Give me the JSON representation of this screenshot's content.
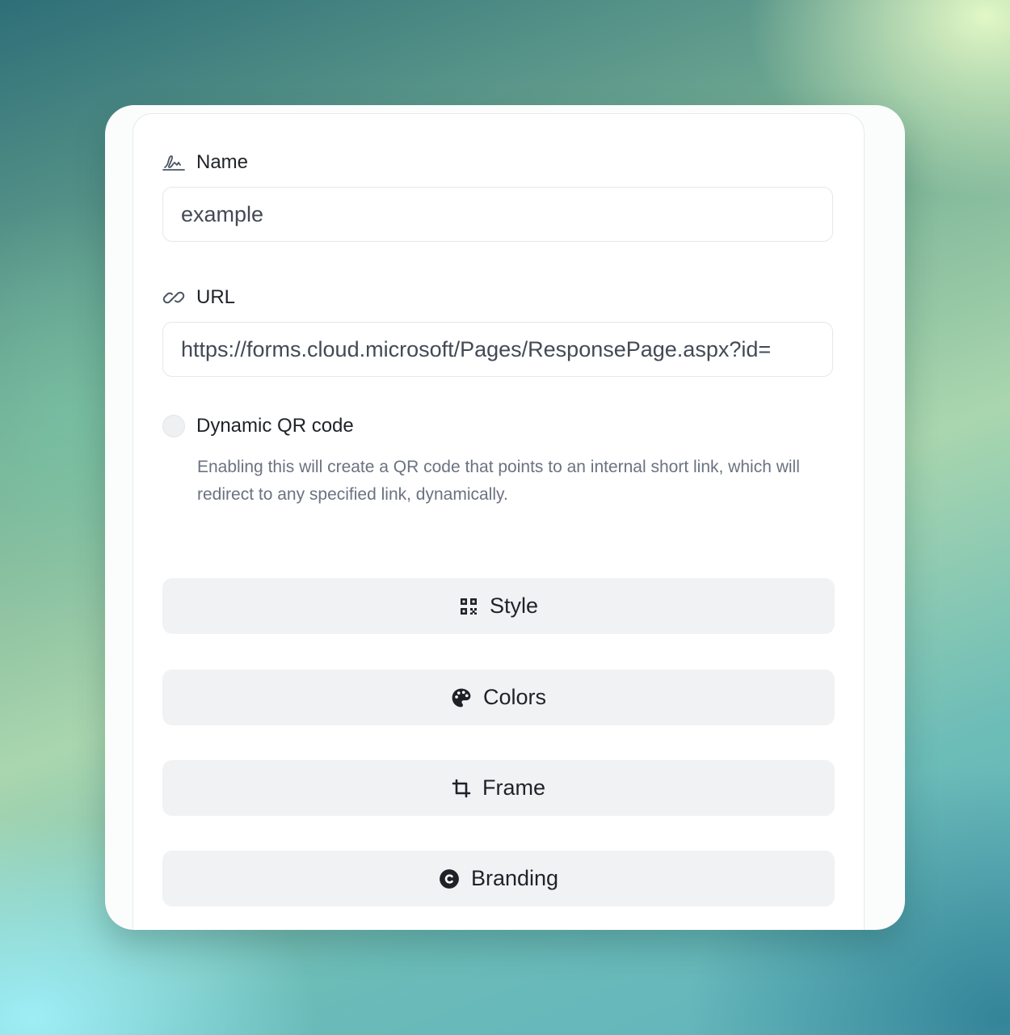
{
  "form": {
    "name_label": "Name",
    "name_icon": "signature-icon",
    "name_value": "example",
    "url_label": "URL",
    "url_icon": "link-icon",
    "url_value": "https://forms.cloud.microsoft/Pages/ResponsePage.aspx?id=",
    "dynamic_qr": {
      "title": "Dynamic QR code",
      "description": "Enabling this will create a QR code that points to an internal short link, which will redirect to any specified link, dynamically.",
      "enabled": false
    }
  },
  "sections": [
    {
      "label": "Style",
      "icon": "qr-code-icon"
    },
    {
      "label": "Colors",
      "icon": "palette-icon"
    },
    {
      "label": "Frame",
      "icon": "crop-icon"
    },
    {
      "label": "Branding",
      "icon": "copyright-icon"
    }
  ],
  "colors": {
    "input_border": "#e5e7eb",
    "button_bg": "#f1f2f4",
    "text_primary": "#1f2328",
    "text_muted": "#6b7280"
  }
}
